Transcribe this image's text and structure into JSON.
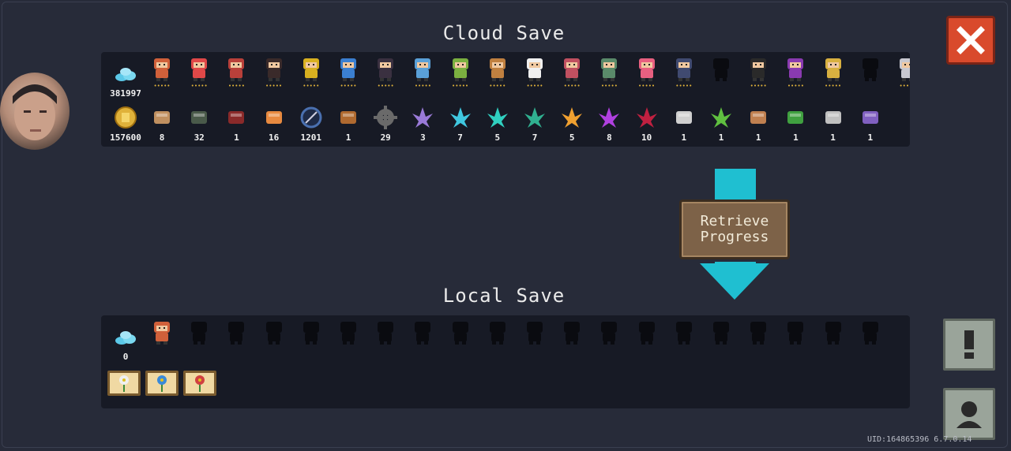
{
  "titles": {
    "cloud": "Cloud Save",
    "local": "Local Save"
  },
  "retrieve_button": {
    "line1": "Retrieve",
    "line2": "Progress"
  },
  "uid_text": "UID:164865396 6.7.0.14",
  "cloud": {
    "gems_count": "381997",
    "gold_count": "157600",
    "character_colors": [
      "#d0603a",
      "#e04848",
      "#b9403a",
      "#3a2a2a",
      "#d8b020",
      "#3b7fd0",
      "#3a3040",
      "#5aa0d8",
      "#7bb040",
      "#c08040",
      "#f0f0f0",
      "#c05060",
      "#5a8a6a",
      "#e86080",
      "#404a70",
      "#101010",
      "#2a2a2a",
      "#8a3ab0",
      "#d8b040",
      "#101010",
      "#c8c8d0"
    ],
    "items": [
      {
        "icon": "mushroom-icon",
        "color": "#c09060",
        "count": "8"
      },
      {
        "icon": "tank-icon",
        "color": "#4a5a4a",
        "count": "32"
      },
      {
        "icon": "wing-icon",
        "color": "#8a2a2a",
        "count": "1"
      },
      {
        "icon": "ore-icon",
        "color": "#e88a40",
        "count": "16"
      },
      {
        "icon": "compass-icon",
        "color": "#4a70b0",
        "count": "1201"
      },
      {
        "icon": "hammer-icon",
        "color": "#b06a30",
        "count": "1"
      },
      {
        "icon": "gear-icon",
        "color": "#6a6a6a",
        "count": "29"
      },
      {
        "icon": "crystal-purple-icon",
        "color": "#9a7ad8",
        "count": "3"
      },
      {
        "icon": "crystal-cyan-icon",
        "color": "#40c8e0",
        "count": "7"
      },
      {
        "icon": "crystal-teal-icon",
        "color": "#30d0c0",
        "count": "5"
      },
      {
        "icon": "crystal-green-icon",
        "color": "#30b090",
        "count": "7"
      },
      {
        "icon": "crystal-orange-icon",
        "color": "#f0a030",
        "count": "5"
      },
      {
        "icon": "crystal-violet-icon",
        "color": "#b040e0",
        "count": "8"
      },
      {
        "icon": "crystal-red-icon",
        "color": "#c02040",
        "count": "10"
      },
      {
        "icon": "card-icon",
        "color": "#d0d0d0",
        "count": "1"
      },
      {
        "icon": "rainbow-crystal-icon",
        "color": "#60c040",
        "count": "1"
      },
      {
        "icon": "block-icon",
        "color": "#c08050",
        "count": "1"
      },
      {
        "icon": "green-machine-icon",
        "color": "#40a040",
        "count": "1"
      },
      {
        "icon": "box-icon",
        "color": "#c0c0c0",
        "count": "1"
      },
      {
        "icon": "book-icon",
        "color": "#8060c0",
        "count": "1"
      }
    ]
  },
  "local": {
    "gems_count": "0",
    "character_count_silhouettes": 20,
    "plants": [
      {
        "icon": "white-flower-icon",
        "color": "#f0f0f0"
      },
      {
        "icon": "blue-flower-icon",
        "color": "#3a8ad8"
      },
      {
        "icon": "red-flower-icon",
        "color": "#d04040"
      }
    ]
  },
  "colors": {
    "accent_cyan": "#1fbfd1",
    "close_red": "#d94a2c",
    "gem_cyan": "#5bc8e8",
    "gold": "#e0b23a"
  }
}
